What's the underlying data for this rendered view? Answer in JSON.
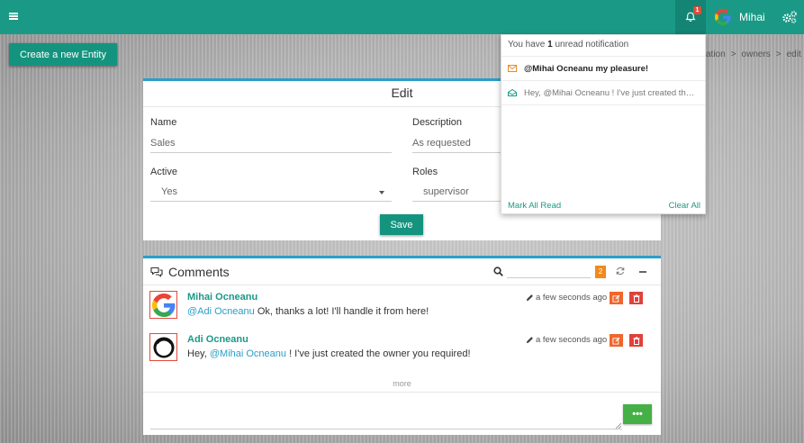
{
  "topbar": {
    "notification_count": "1",
    "user_name": "Mihai"
  },
  "actions": {
    "create_label": "Create a new Entity"
  },
  "breadcrumb": {
    "items": [
      "ation",
      "owners",
      "edit"
    ],
    "separator": ">"
  },
  "edit_form": {
    "title": "Edit",
    "name_label": "Name",
    "name_value": "Sales",
    "description_label": "Description",
    "description_value": "As requested",
    "active_label": "Active",
    "active_value": "Yes",
    "roles_label": "Roles",
    "roles_value": "supervisor",
    "save_label": "Save"
  },
  "comments": {
    "title": "Comments",
    "count": "2",
    "items": [
      {
        "author": "Mihai Ocneanu",
        "mention": "@Adi Ocneanu",
        "text": " Ok, thanks a lot! I'll handle it from here!",
        "time": "a few seconds ago",
        "avatar": "google-g-icon"
      },
      {
        "author": "Adi Ocneanu",
        "prefix": "Hey, ",
        "mention": "@Mihai Ocneanu",
        "text": " ! I've just created the owner you required!",
        "time": "a few seconds ago",
        "avatar": "ring-icon"
      }
    ],
    "more_label": "more",
    "send_label": "•••"
  },
  "notifications": {
    "header_pre": "You have ",
    "header_count": "1",
    "header_post": " unread notification",
    "items": [
      {
        "text": "@Mihai Ocneanu my pleasure!",
        "state": "unread",
        "icon": "envelope-icon"
      },
      {
        "text": "Hey, @Mihai Ocneanu ! I've just created the owner you required!",
        "state": "read",
        "icon": "envelope-open-icon"
      }
    ],
    "mark_all_label": "Mark All Read",
    "clear_all_label": "Clear All"
  },
  "colors": {
    "primary": "#1a9a86",
    "panel_accent": "#2a9ec7",
    "badge_orange": "#f08a1c",
    "edit_button": "#f0662b",
    "delete_button": "#e0413a",
    "send_button": "#45b045"
  }
}
